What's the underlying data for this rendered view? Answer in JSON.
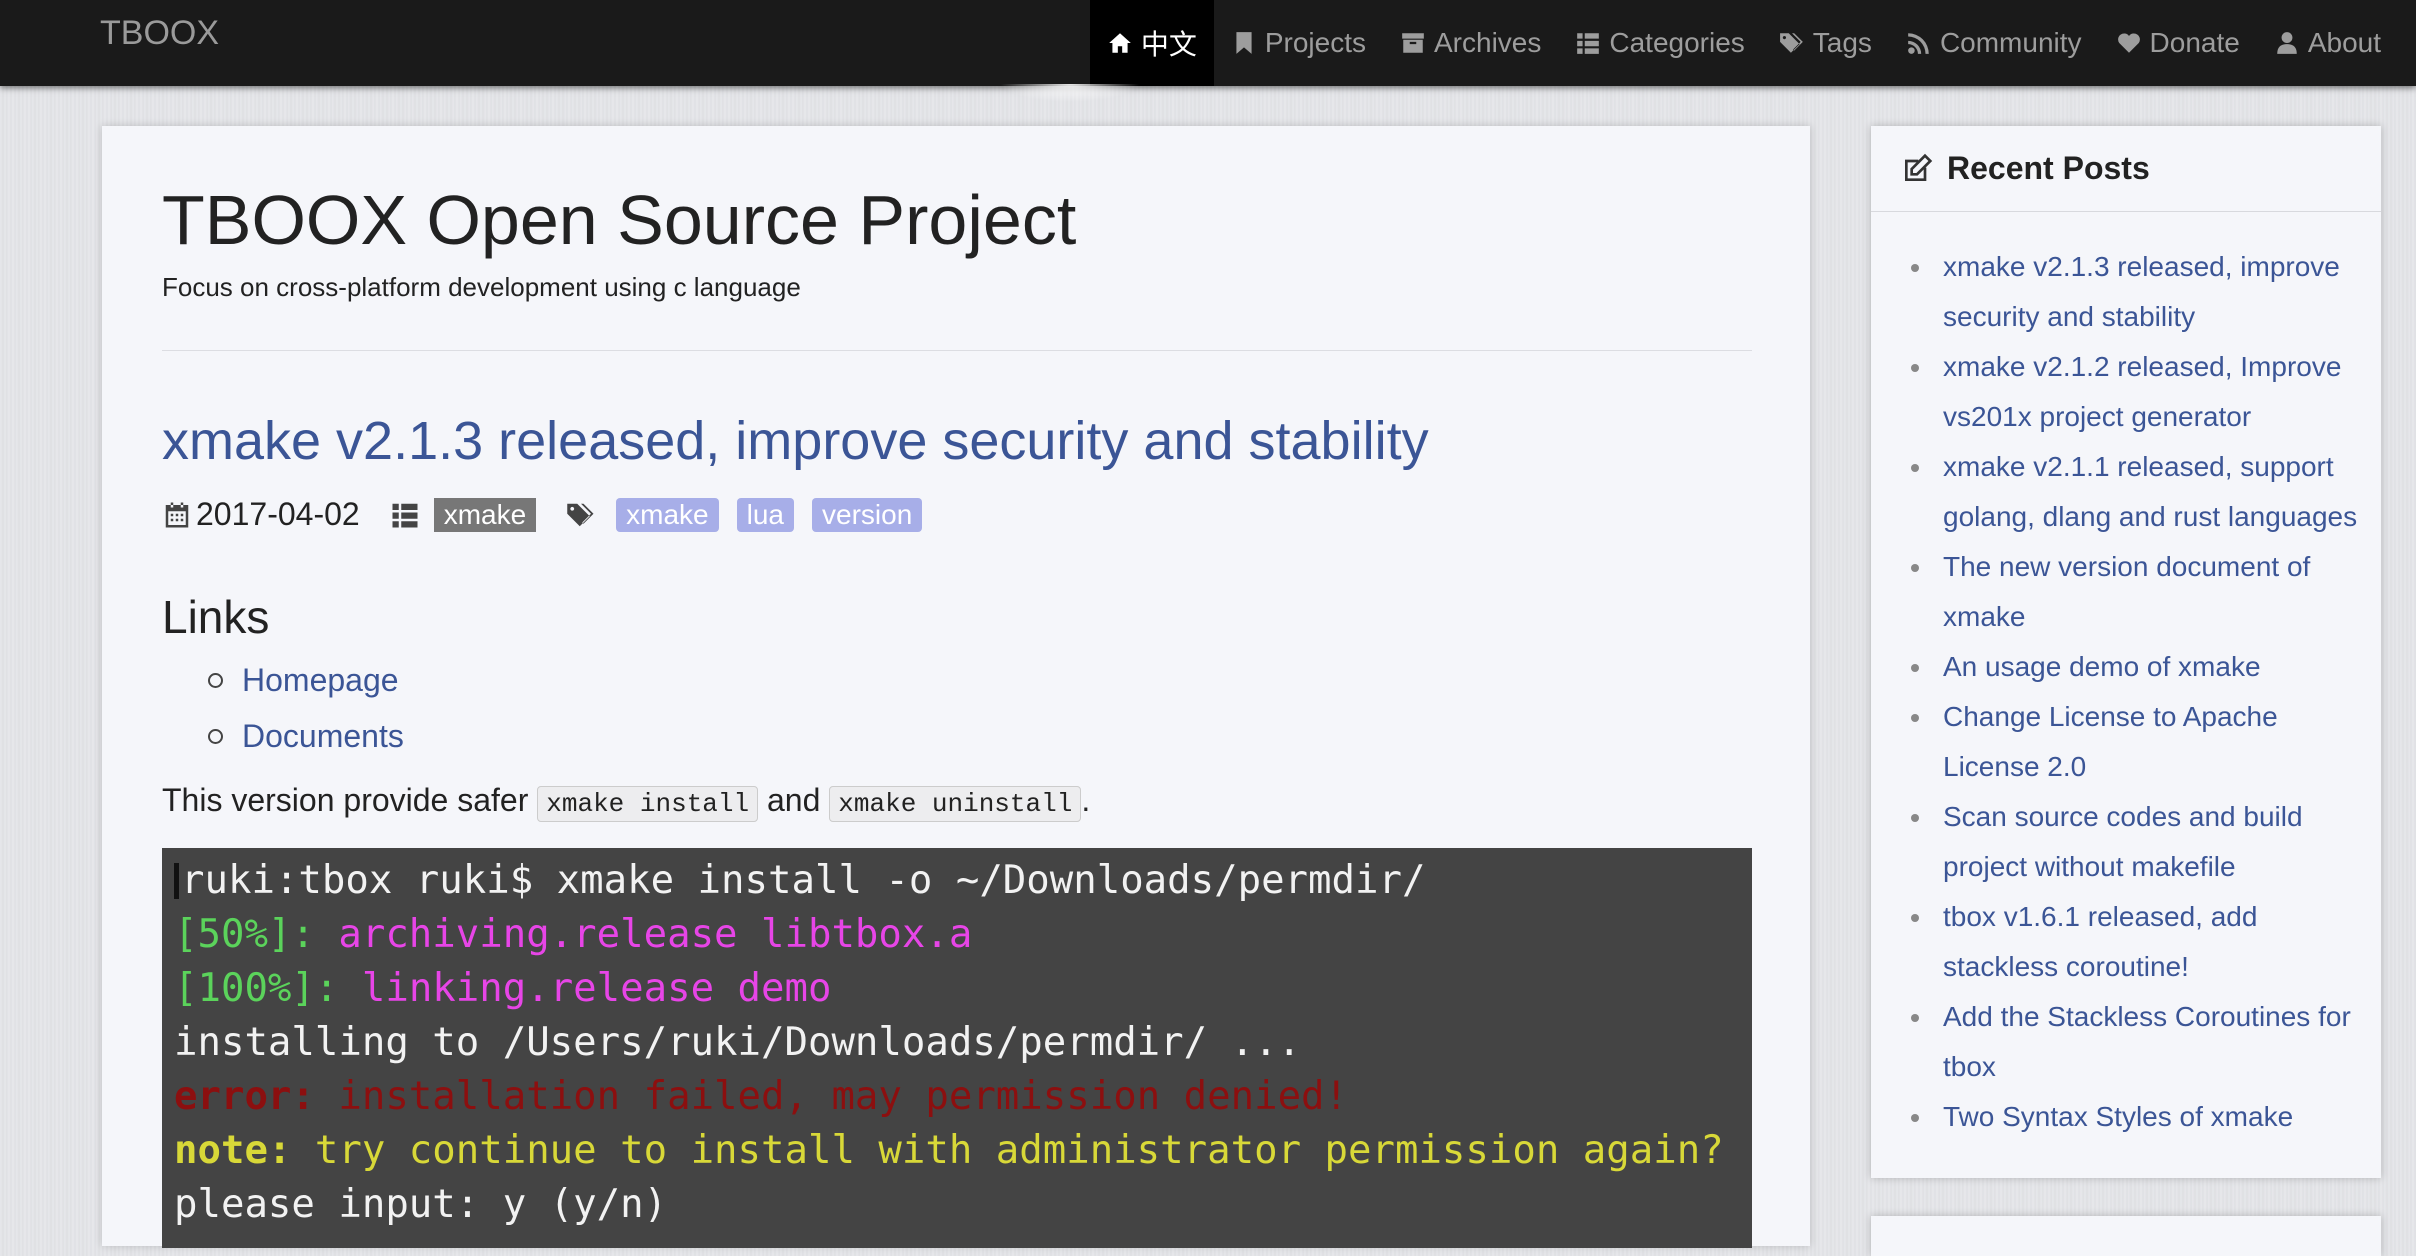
{
  "nav": {
    "brand": "TBOOX",
    "items": [
      {
        "label": "中文",
        "icon": "home-icon"
      },
      {
        "label": "Projects",
        "icon": "bookmark-icon"
      },
      {
        "label": "Archives",
        "icon": "archive-icon"
      },
      {
        "label": "Categories",
        "icon": "list-icon"
      },
      {
        "label": "Tags",
        "icon": "tags-icon"
      },
      {
        "label": "Community",
        "icon": "feed-icon"
      },
      {
        "label": "Donate",
        "icon": "heart-icon"
      },
      {
        "label": "About",
        "icon": "user-icon"
      }
    ]
  },
  "site": {
    "title": "TBOOX Open Source Project",
    "subtitle": "Focus on cross-platform development using c language"
  },
  "post": {
    "title": "xmake v2.1.3 released, improve security and stability",
    "date": "2017-04-02",
    "category": "xmake",
    "tags": [
      "xmake",
      "lua",
      "version"
    ],
    "links_heading": "Links",
    "links": [
      "Homepage",
      "Documents"
    ],
    "para_prefix": "This version provide safer ",
    "code1": "xmake install",
    "para_mid": " and ",
    "code2": "xmake uninstall",
    "para_suffix": ".",
    "terminal": {
      "line1": "ruki:tbox ruki$ xmake install -o ~/Downloads/permdir/",
      "line2_pct": "[50%]:",
      "line2_msg": " archiving.release libtbox.a",
      "line3_pct": "[100%]:",
      "line3_msg": " linking.release demo",
      "line4": "installing to /Users/ruki/Downloads/permdir/ ...",
      "line5_label": "error:",
      "line5_msg": " installation failed, may permission denied!",
      "line6_label": "note:",
      "line6_msg": " try continue to install with administrator permission again?",
      "line7": "please input: y (y/n)"
    }
  },
  "sidebar": {
    "title": "Recent Posts",
    "posts": [
      "xmake v2.1.3 released, improve security and stability",
      "xmake v2.1.2 released, Improve vs201x project generator",
      "xmake v2.1.1 released, support golang, dlang and rust languages",
      "The new version document of xmake",
      "An usage demo of xmake",
      "Change License to Apache License 2.0",
      "Scan source codes and build project without makefile",
      "tbox v1.6.1 released, add stackless coroutine!",
      "Add the Stackless Coroutines for tbox",
      "Two Syntax Styles of xmake"
    ]
  },
  "colors": {
    "link": "#3b5596",
    "navbar": "#1a1a1a",
    "tag_badge": "#a7aee8",
    "category_badge": "#777777",
    "terminal_bg": "#444444"
  }
}
